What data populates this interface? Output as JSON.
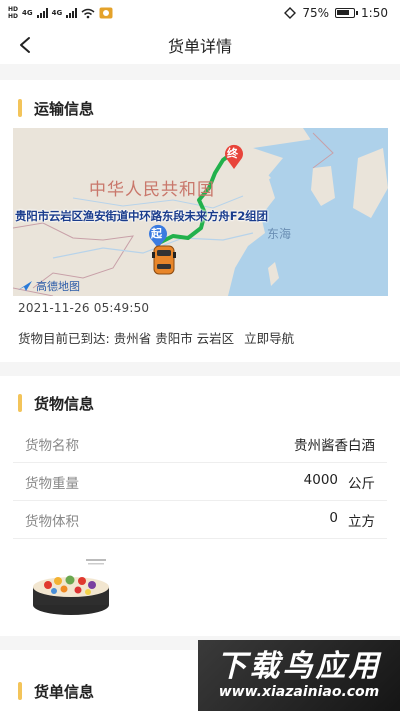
{
  "status_bar": {
    "hd_top": "HD",
    "hd_bottom": "HD",
    "network_1": "4G",
    "network_2": "4G",
    "battery": "75%",
    "time": "1:50"
  },
  "header": {
    "title": "货单详情"
  },
  "transport": {
    "section_title": "运输信息",
    "map": {
      "address_label": "贵阳市云岩区渔安街道中环路东段未来方舟F2组团",
      "country_label": "中华人民共和国",
      "sea_label": "东海",
      "start_marker": "起",
      "end_marker": "终",
      "provider_logo": "高德地图"
    },
    "timestamp": "2021-11-26 05:49:50",
    "arrive_prefix": "货物目前已到达:",
    "arrive_location": "贵州省 贵阳市 云岩区",
    "navigate_label": "立即导航"
  },
  "goods": {
    "section_title": "货物信息",
    "rows": [
      {
        "label": "货物名称",
        "value": "贵州酱香白酒",
        "unit": ""
      },
      {
        "label": "货物重量",
        "value": "4000",
        "unit": "公斤"
      },
      {
        "label": "货物体积",
        "value": "0",
        "unit": "立方"
      }
    ]
  },
  "waybill": {
    "section_title": "货单信息"
  },
  "watermark": {
    "brand": "下载鸟应用",
    "url": "www.xiazainiao.com"
  },
  "colors": {
    "accent": "#f3c45a",
    "route": "#22b14c",
    "end_pin": "#e8443a",
    "start_pin": "#3a7be0"
  }
}
